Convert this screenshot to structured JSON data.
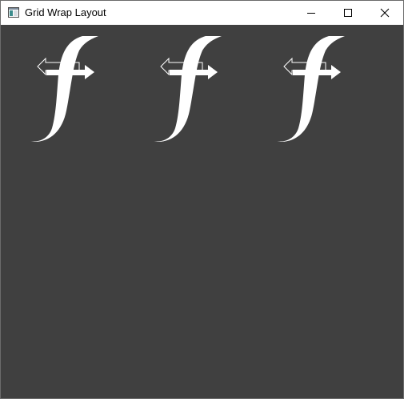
{
  "window": {
    "title": "Grid Wrap Layout",
    "app_icon": "window-app-icon",
    "controls": [
      "minimize-icon",
      "maximize-icon",
      "close-icon"
    ]
  },
  "content": {
    "background": "#404040",
    "tiles": [
      {
        "icon": "function-arrow-icon",
        "color": "#ffffff"
      },
      {
        "icon": "function-arrow-icon",
        "color": "#ffffff"
      },
      {
        "icon": "function-arrow-icon",
        "color": "#ffffff"
      }
    ]
  }
}
